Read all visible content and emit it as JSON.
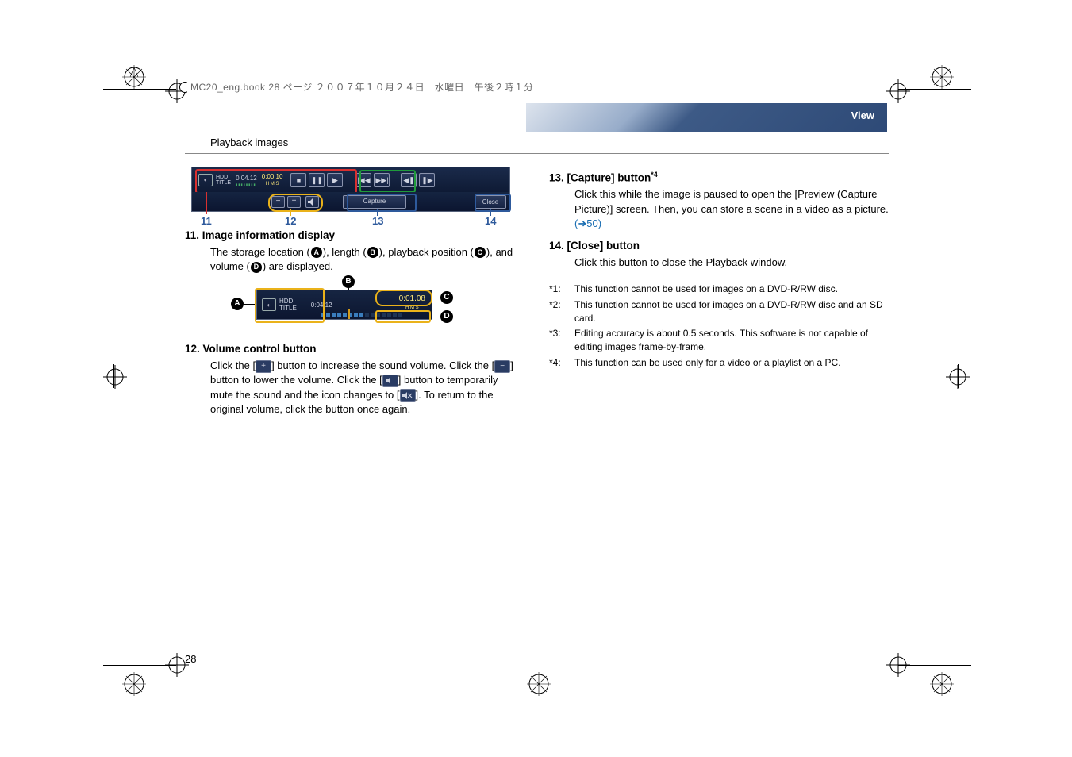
{
  "top_line": "MC20_eng.book  28 ページ  ２００７年１０月２４日　水曜日　午後２時１分",
  "header": {
    "section": "Playback images",
    "view_tab": "View"
  },
  "playback_bar": {
    "source_line1": "HDD",
    "source_line2": "TITLE",
    "length": "0:04.12",
    "hms_top": "0:00.10",
    "hms_labels": "H    M    S",
    "capture": "Capture",
    "close": "Close"
  },
  "callouts": {
    "c11": "11",
    "c12": "12",
    "c13": "13",
    "c14": "14"
  },
  "item11": {
    "title": "11. Image information display",
    "text_pre": "The storage location (",
    "a": "A",
    "t2": "), length (",
    "b": "B",
    "t3": "), playback position (",
    "c": "C",
    "t4": "), and volume (",
    "d": "D",
    "t5": ") are displayed."
  },
  "detail": {
    "source_line1": "HDD",
    "source_line2": "TITLE",
    "length": "0:04.12",
    "hms": "0:01.08",
    "hms_labels": "H    M    S"
  },
  "labels_abcd": {
    "a": "A",
    "b": "B",
    "c": "C",
    "d": "D"
  },
  "item12": {
    "title": "12. Volume control button",
    "p1a": "Click the [",
    "p1b": "] button to increase the sound volume. Click the [",
    "p1c": "] button to lower the volume. Click the [",
    "p1d": "] button to temporarily mute the sound and the icon changes to [",
    "p1e": "]. To return to the original volume, click the button once again."
  },
  "item13": {
    "title_pre": "13. [Capture] button",
    "title_sup": "*4",
    "body_pre": "Click this while the image is paused to open the [Preview (Capture Picture)] screen. Then, you can store a scene in a video as a picture. ",
    "link": "(➜50)"
  },
  "item14": {
    "title": "14. [Close] button",
    "body": "Click this button to close the Playback window."
  },
  "footnotes": {
    "f1k": "*1:",
    "f1": "This function cannot be used for images on a DVD-R/RW disc.",
    "f2k": "*2:",
    "f2": "This function cannot be used for images on a DVD-R/RW disc and an SD card.",
    "f3k": "*3:",
    "f3": "Editing accuracy is about 0.5 seconds. This software is not capable of editing images frame-by-frame.",
    "f4k": "*4:",
    "f4": "This function can be used only for a video or a playlist on a PC."
  },
  "page_number": "28"
}
